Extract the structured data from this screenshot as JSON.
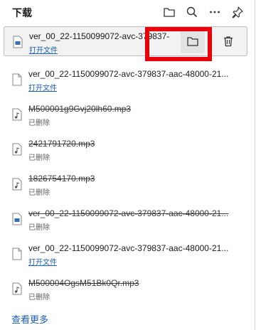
{
  "header": {
    "title": "下载",
    "icons": [
      "folder-icon",
      "search-icon",
      "more-icon",
      "pin-icon"
    ]
  },
  "downloads": [
    {
      "name": "ver_00_22-1150099072-avc-379837-",
      "status": "打开文件",
      "deleted": false,
      "kind": "video"
    },
    {
      "name": "ver_00_22-1150099072-avc-379837-aac-48000-21...",
      "status": "打开文件",
      "deleted": false,
      "kind": "file"
    },
    {
      "name": "M500001g9Gvj20lh60.mp3",
      "status": "已删除",
      "deleted": true,
      "kind": "audio"
    },
    {
      "name": "2421791720.mp3",
      "status": "已删除",
      "deleted": true,
      "kind": "audio"
    },
    {
      "name": "1826754170.mp3",
      "status": "已删除",
      "deleted": true,
      "kind": "audio"
    },
    {
      "name": "ver_00_22-1150099072-avc-379837-aac-48000-21...",
      "status": "已删除",
      "deleted": true,
      "kind": "video"
    },
    {
      "name": "ver_00_22-1150099072-avc-379837-aac-48000-21...",
      "status": "打开文件",
      "deleted": false,
      "kind": "file"
    },
    {
      "name": "M500004OgsM51Bk0Qr.mp3",
      "status": "已删除",
      "deleted": true,
      "kind": "audio"
    }
  ],
  "footer": {
    "see_more": "查看更多"
  },
  "colors": {
    "accent_link": "#1a5fb4",
    "highlight": "#e8000b"
  }
}
